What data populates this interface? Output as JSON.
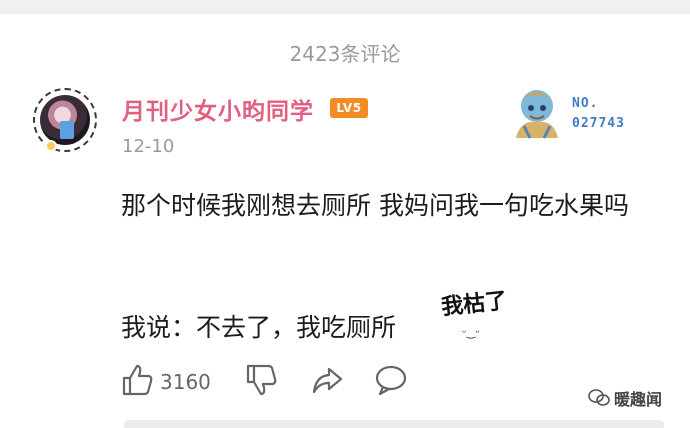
{
  "header": {
    "comment_count": "2423条评论"
  },
  "comment": {
    "username": "月刊少女小昀同学",
    "level_badge": "LV5",
    "date": "12-10",
    "card_number_line1": "NO.",
    "card_number_line2": "027743",
    "text_line1": "那个时候我刚想去厕所 我妈问我一句吃水果吗",
    "text_line2": "我说：不去了，我吃厕所",
    "sticker_text": "我枯了",
    "likes": "3160"
  },
  "watermark": {
    "text": "暖趣闻"
  },
  "colors": {
    "username": "#e2607f",
    "level_badge": "#f48c25",
    "muted_text": "#9a9a9a",
    "card_number": "#3f7dc4"
  },
  "icons": [
    "like-icon",
    "dislike-icon",
    "share-icon",
    "reply-icon",
    "wechat-icon"
  ]
}
